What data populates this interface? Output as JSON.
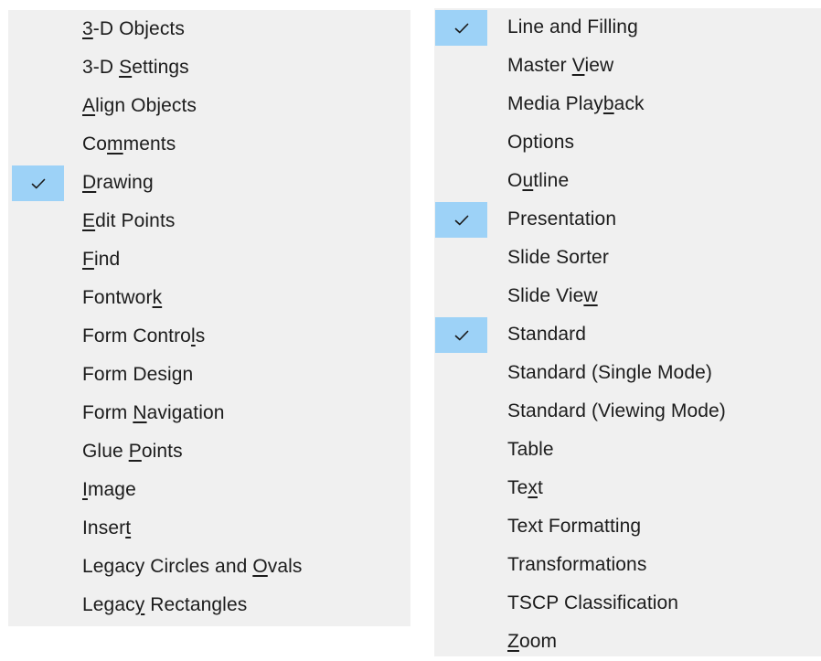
{
  "left_menu": {
    "items": [
      {
        "label": "3-D Objects",
        "mnemonic": 0,
        "checked": false
      },
      {
        "label": "3-D Settings",
        "mnemonic": 4,
        "checked": false
      },
      {
        "label": "Align Objects",
        "mnemonic": 0,
        "checked": false
      },
      {
        "label": "Comments",
        "mnemonic": 2,
        "checked": false
      },
      {
        "label": "Drawing",
        "mnemonic": 0,
        "checked": true
      },
      {
        "label": "Edit Points",
        "mnemonic": 0,
        "checked": false
      },
      {
        "label": "Find",
        "mnemonic": 0,
        "checked": false
      },
      {
        "label": "Fontwork",
        "mnemonic": 7,
        "checked": false
      },
      {
        "label": "Form Controls",
        "mnemonic": 11,
        "checked": false
      },
      {
        "label": "Form Design",
        "mnemonic": -1,
        "checked": false
      },
      {
        "label": "Form Navigation",
        "mnemonic": 5,
        "checked": false
      },
      {
        "label": "Glue Points",
        "mnemonic": 5,
        "checked": false
      },
      {
        "label": "Image",
        "mnemonic": 0,
        "checked": false
      },
      {
        "label": "Insert",
        "mnemonic": 5,
        "checked": false
      },
      {
        "label": "Legacy Circles and Ovals",
        "mnemonic": 19,
        "checked": false
      },
      {
        "label": "Legacy Rectangles",
        "mnemonic": 5,
        "checked": false
      }
    ]
  },
  "right_menu": {
    "items": [
      {
        "label": "Line and Filling",
        "mnemonic": -1,
        "checked": true
      },
      {
        "label": "Master View",
        "mnemonic": 7,
        "checked": false
      },
      {
        "label": "Media Playback",
        "mnemonic": 10,
        "checked": false
      },
      {
        "label": "Options",
        "mnemonic": -1,
        "checked": false
      },
      {
        "label": "Outline",
        "mnemonic": 1,
        "checked": false
      },
      {
        "label": "Presentation",
        "mnemonic": -1,
        "checked": true
      },
      {
        "label": "Slide Sorter",
        "mnemonic": -1,
        "checked": false
      },
      {
        "label": "Slide View",
        "mnemonic": 9,
        "checked": false
      },
      {
        "label": "Standard",
        "mnemonic": -1,
        "checked": true
      },
      {
        "label": "Standard (Single Mode)",
        "mnemonic": -1,
        "checked": false
      },
      {
        "label": "Standard (Viewing Mode)",
        "mnemonic": -1,
        "checked": false
      },
      {
        "label": "Table",
        "mnemonic": -1,
        "checked": false
      },
      {
        "label": "Text",
        "mnemonic": 2,
        "checked": false
      },
      {
        "label": "Text Formatting",
        "mnemonic": -1,
        "checked": false
      },
      {
        "label": "Transformations",
        "mnemonic": -1,
        "checked": false
      },
      {
        "label": "TSCP Classification",
        "mnemonic": -1,
        "checked": false
      },
      {
        "label": "Zoom",
        "mnemonic": 0,
        "checked": false
      }
    ]
  },
  "colors": {
    "menu_background": "#f0f0f0",
    "check_highlight": "#9dd2f7",
    "text": "#1c1c1c",
    "checkmark": "#1a1a1a"
  },
  "icons": {
    "checkmark": "checkmark-icon"
  }
}
